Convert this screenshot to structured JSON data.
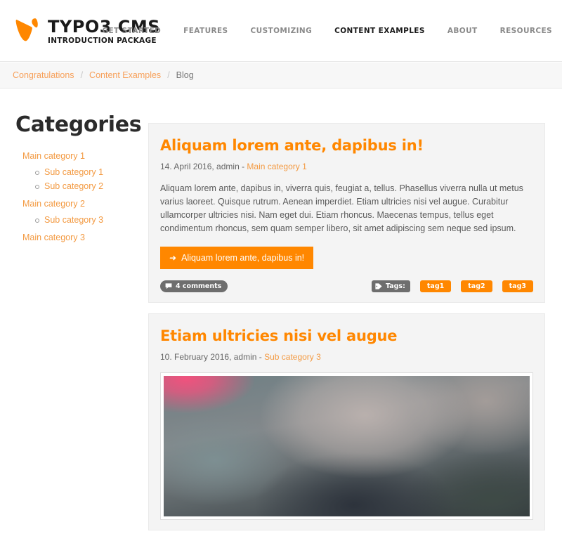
{
  "site": {
    "logo_title": "TYPO3 CMS",
    "logo_subtitle": "INTRODUCTION PACKAGE",
    "logo_icon": "typo3-logo-icon"
  },
  "nav": {
    "items": [
      {
        "label": "GET STARTED",
        "active": false
      },
      {
        "label": "FEATURES",
        "active": false
      },
      {
        "label": "CUSTOMIZING",
        "active": false
      },
      {
        "label": "CONTENT EXAMPLES",
        "active": true
      },
      {
        "label": "ABOUT",
        "active": false
      },
      {
        "label": "RESOURCES",
        "active": false
      }
    ],
    "accent_color": "#ff8700"
  },
  "breadcrumb": {
    "separator": "/",
    "items": [
      {
        "label": "Congratulations",
        "current": false
      },
      {
        "label": "Content Examples",
        "current": false
      },
      {
        "label": "Blog",
        "current": true
      }
    ]
  },
  "sidebar": {
    "title": "Categories",
    "categories": [
      {
        "label": "Main category 1",
        "subs": [
          {
            "label": "Sub category 1"
          },
          {
            "label": "Sub category 2"
          }
        ]
      },
      {
        "label": "Main category 2",
        "subs": [
          {
            "label": "Sub category 3"
          }
        ]
      },
      {
        "label": "Main category 3",
        "subs": []
      }
    ]
  },
  "articles": [
    {
      "title": "Aliquam lorem ante, dapibus in!",
      "meta_date": "14. April 2016, admin - ",
      "meta_category": "Main category 1",
      "body": "Aliquam lorem ante, dapibus in, viverra quis, feugiat a, tellus. Phasellus viverra nulla ut metus varius laoreet. Quisque rutrum. Aenean imperdiet. Etiam ultricies nisi vel augue. Curabitur ullamcorper ultricies nisi. Nam eget dui. Etiam rhoncus. Maecenas tempus, tellus eget condimentum rhoncus, sem quam semper libero, sit amet adipiscing sem neque sed ipsum.",
      "read_more_label": "Aliquam lorem ante, dapibus in!",
      "read_more_arrow": "➜",
      "comments_label": "4 comments",
      "comments_icon": "speech-bubble-icon",
      "tags_label": "Tags:",
      "tags_icon": "tag-icon",
      "tags": [
        "tag1",
        "tag2",
        "tag3"
      ],
      "has_photo": false
    },
    {
      "title": "Etiam ultricies nisi vel augue",
      "meta_date": "10. February 2016, admin - ",
      "meta_category": "Sub category 3",
      "has_photo": true,
      "photo_alt": "blurred photograph"
    }
  ],
  "colors": {
    "brand_orange": "#ff8700",
    "link_orange": "#f39a42",
    "badge_gray": "#6e6e6e",
    "card_bg": "#f4f4f4",
    "breadcrumb_bg": "#f7f7f7"
  }
}
